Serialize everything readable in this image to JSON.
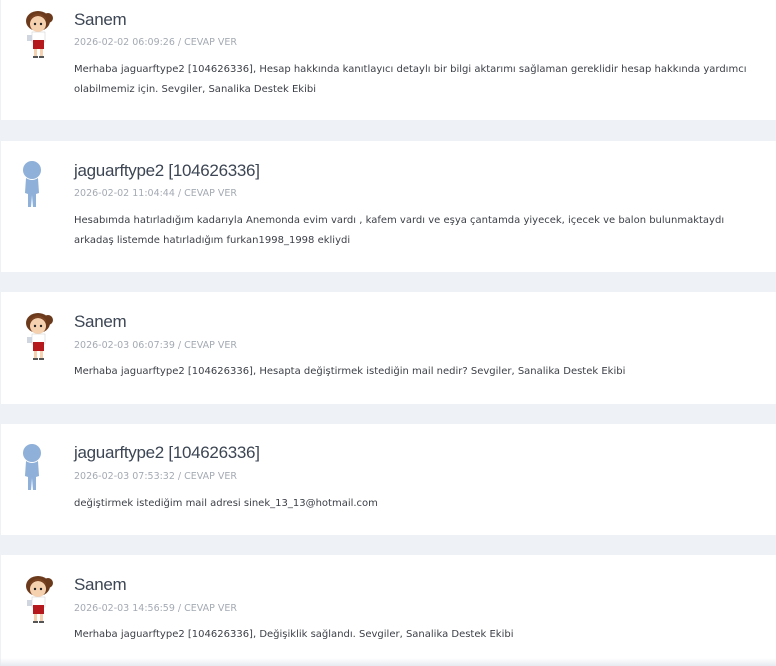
{
  "messages": [
    {
      "author": "Sanem",
      "avatar": "female-character-avatar",
      "timestamp": "2026-02-02 06:09:26",
      "reply_label": "CEVAP VER",
      "text": "Merhaba jaguarftype2 [104626336], Hesap hakkında kanıtlayıcı detaylı bir bilgi aktarımı sağlaman gereklidir hesap hakkında yardımcı olabilmemiz için. Sevgiler, Sanalika Destek Ekibi"
    },
    {
      "author": "jaguarftype2 [104626336]",
      "avatar": "default-user-silhouette",
      "timestamp": "2026-02-02 11:04:44",
      "reply_label": "CEVAP VER",
      "text": "Hesabımda hatırladığım kadarıyla Anemonda evim vardı , kafem vardı ve eşya çantamda yiyecek, içecek ve balon bulunmaktaydı arkadaş listemde hatırladığım furkan1998_1998 ekliydi"
    },
    {
      "author": "Sanem",
      "avatar": "female-character-avatar",
      "timestamp": "2026-02-03 06:07:39",
      "reply_label": "CEVAP VER",
      "text": "Merhaba jaguarftype2 [104626336], Hesapta değiştirmek istediğin mail nedir? Sevgiler, Sanalika Destek Ekibi"
    },
    {
      "author": "jaguarftype2 [104626336]",
      "avatar": "default-user-silhouette",
      "timestamp": "2026-02-03 07:53:32",
      "reply_label": "CEVAP VER",
      "text": "değiştirmek istediğim mail adresi sinek_13_13@hotmail.com"
    },
    {
      "author": "Sanem",
      "avatar": "female-character-avatar",
      "timestamp": "2026-02-03 14:56:59",
      "reply_label": "CEVAP VER",
      "text": "Merhaba jaguarftype2 [104626336], Değişiklik sağlandı. Sevgiler, Sanalika Destek Ekibi"
    }
  ],
  "colors": {
    "background": "#eef2f7",
    "card": "#ffffff",
    "name": "#3d4654",
    "meta": "#a4aab3",
    "text": "#3b3f46",
    "silhouette": "#8fb0d8"
  }
}
